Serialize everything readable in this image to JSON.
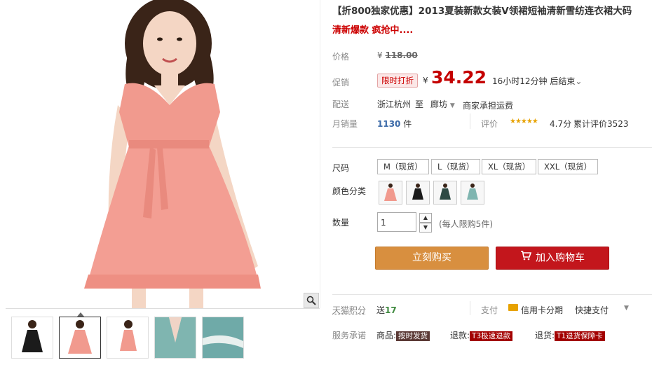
{
  "product": {
    "title": "【折800独家优惠】2013夏装新款女装V领裙短袖清新雪纺连衣裙大码",
    "subtitle": "清新爆款 疯抢中...."
  },
  "price": {
    "label": "价格",
    "currency": "¥",
    "original": "118.00"
  },
  "promo": {
    "label": "促销",
    "badge": "限时打折",
    "currency": "¥",
    "price": "34.22",
    "countdown": "16小时12分钟 后结束",
    "chevron": "⌄"
  },
  "delivery": {
    "label": "配送",
    "from": "浙江杭州",
    "to_word": "至",
    "to": "廊坊",
    "shipping": "商家承担运费"
  },
  "sales": {
    "label": "月销量",
    "count": "1130",
    "unit": "件",
    "rating_label": "评价",
    "stars": "★★★★★",
    "rating": "4.7分",
    "total_reviews": "累计评价3523"
  },
  "sizes": {
    "label": "尺码",
    "options": [
      "M（现货）",
      "L（现货）",
      "XL（现货）",
      "XXL（现货）"
    ]
  },
  "colors": {
    "label": "颜色分类"
  },
  "quantity": {
    "label": "数量",
    "value": "1",
    "limit": "(每人限购5件)"
  },
  "buttons": {
    "buy": "立刻购买",
    "cart": "加入购物车"
  },
  "points": {
    "label": "天猫积分",
    "send": "送",
    "value": "17",
    "pay_label": "支付",
    "credit": "信用卡分期",
    "quick": "快捷支付"
  },
  "service": {
    "label": "服务承诺",
    "goods": "商品:",
    "goods_tag": "按时发货",
    "refund": "退款:",
    "refund_tag": "T3极速退款",
    "return": "退货:",
    "return_tag": "T1退货保障卡"
  },
  "colors_map": {
    "accent_red": "#c40000",
    "buy_orange": "#d88f3f",
    "cart_red": "#c3161c",
    "dress_pink": "#f0948a"
  }
}
